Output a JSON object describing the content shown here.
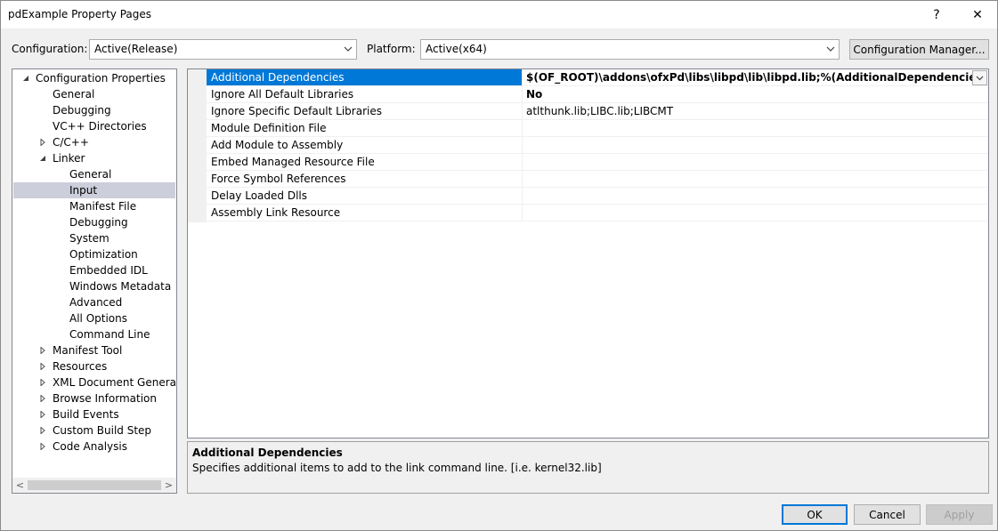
{
  "window": {
    "title": "pdExample Property Pages",
    "help_label": "?",
    "close_label": "✕"
  },
  "config": {
    "configuration_label": "Configuration:",
    "configuration_value": "Active(Release)",
    "platform_label": "Platform:",
    "platform_value": "Active(x64)",
    "manager_button": "Configuration Manager..."
  },
  "tree": {
    "items": [
      {
        "label": "Configuration Properties",
        "level": 0,
        "expander": "expanded"
      },
      {
        "label": "General",
        "level": 1,
        "expander": "none"
      },
      {
        "label": "Debugging",
        "level": 1,
        "expander": "none"
      },
      {
        "label": "VC++ Directories",
        "level": 1,
        "expander": "none"
      },
      {
        "label": "C/C++",
        "level": 1,
        "expander": "collapsed"
      },
      {
        "label": "Linker",
        "level": 1,
        "expander": "expanded"
      },
      {
        "label": "General",
        "level": 2,
        "expander": "none"
      },
      {
        "label": "Input",
        "level": 2,
        "expander": "none",
        "selected": true
      },
      {
        "label": "Manifest File",
        "level": 2,
        "expander": "none"
      },
      {
        "label": "Debugging",
        "level": 2,
        "expander": "none"
      },
      {
        "label": "System",
        "level": 2,
        "expander": "none"
      },
      {
        "label": "Optimization",
        "level": 2,
        "expander": "none"
      },
      {
        "label": "Embedded IDL",
        "level": 2,
        "expander": "none"
      },
      {
        "label": "Windows Metadata",
        "level": 2,
        "expander": "none"
      },
      {
        "label": "Advanced",
        "level": 2,
        "expander": "none"
      },
      {
        "label": "All Options",
        "level": 2,
        "expander": "none"
      },
      {
        "label": "Command Line",
        "level": 2,
        "expander": "none"
      },
      {
        "label": "Manifest Tool",
        "level": 1,
        "expander": "collapsed"
      },
      {
        "label": "Resources",
        "level": 1,
        "expander": "collapsed"
      },
      {
        "label": "XML Document Generator",
        "level": 1,
        "expander": "collapsed"
      },
      {
        "label": "Browse Information",
        "level": 1,
        "expander": "collapsed"
      },
      {
        "label": "Build Events",
        "level": 1,
        "expander": "collapsed"
      },
      {
        "label": "Custom Build Step",
        "level": 1,
        "expander": "collapsed"
      },
      {
        "label": "Code Analysis",
        "level": 1,
        "expander": "collapsed"
      }
    ]
  },
  "properties": [
    {
      "name": "Additional Dependencies",
      "value": "$(OF_ROOT)\\addons\\ofxPd\\libs\\libpd\\lib\\libpd.lib;%(AdditionalDependencies)",
      "bold": true,
      "selected": true
    },
    {
      "name": "Ignore All Default Libraries",
      "value": "No",
      "bold": true
    },
    {
      "name": "Ignore Specific Default Libraries",
      "value": "atlthunk.lib;LIBC.lib;LIBCMT",
      "bold": false
    },
    {
      "name": "Module Definition File",
      "value": "",
      "bold": false
    },
    {
      "name": "Add Module to Assembly",
      "value": "",
      "bold": false
    },
    {
      "name": "Embed Managed Resource File",
      "value": "",
      "bold": false
    },
    {
      "name": "Force Symbol References",
      "value": "",
      "bold": false
    },
    {
      "name": "Delay Loaded Dlls",
      "value": "",
      "bold": false
    },
    {
      "name": "Assembly Link Resource",
      "value": "",
      "bold": false
    }
  ],
  "description": {
    "title": "Additional Dependencies",
    "text": "Specifies additional items to add to the link command line. [i.e. kernel32.lib]"
  },
  "buttons": {
    "ok": "OK",
    "cancel": "Cancel",
    "apply": "Apply"
  },
  "colors": {
    "selection_blue": "#0078d7",
    "tree_selected": "#cccedb",
    "dialog_bg": "#f0f0f0"
  }
}
